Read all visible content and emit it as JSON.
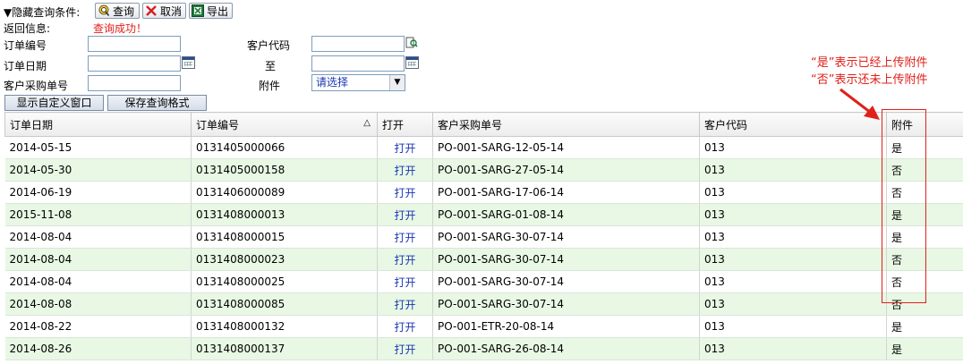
{
  "toolbar": {
    "toggle_label": "▼隐藏查询条件:",
    "query_label": "查询",
    "cancel_label": "取消",
    "export_label": "导出"
  },
  "message": {
    "label": "返回信息:",
    "value": "查询成功！"
  },
  "filters": {
    "order_no_label": "订单编号",
    "order_no_value": "",
    "customer_code_label": "客户代码",
    "customer_code_value": "",
    "order_date_label": "订单日期",
    "date_from_value": "",
    "to_label": "至",
    "date_to_value": "",
    "po_no_label": "客户采购单号",
    "po_no_value": "",
    "attachment_label": "附件",
    "attachment_selected": "请选择"
  },
  "buttons": {
    "custom_window": "显示自定义窗口",
    "save_format": "保存查询格式"
  },
  "table": {
    "headers": [
      "订单日期",
      "订单编号",
      "打开",
      "客户采购单号",
      "客户代码",
      "附件"
    ],
    "sort_indicator": "△",
    "rows": [
      [
        "2014-05-15",
        "0131405000066",
        "打开",
        "PO-001-SARG-12-05-14",
        "013",
        "是"
      ],
      [
        "2014-05-30",
        "0131405000158",
        "打开",
        "PO-001-SARG-27-05-14",
        "013",
        "否"
      ],
      [
        "2014-06-19",
        "0131406000089",
        "打开",
        "PO-001-SARG-17-06-14",
        "013",
        "否"
      ],
      [
        "2015-11-08",
        "0131408000013",
        "打开",
        "PO-001-SARG-01-08-14",
        "013",
        "是"
      ],
      [
        "2014-08-04",
        "0131408000015",
        "打开",
        "PO-001-SARG-30-07-14",
        "013",
        "是"
      ],
      [
        "2014-08-04",
        "0131408000023",
        "打开",
        "PO-001-SARG-30-07-14",
        "013",
        "否"
      ],
      [
        "2014-08-04",
        "0131408000025",
        "打开",
        "PO-001-SARG-30-07-14",
        "013",
        "否"
      ],
      [
        "2014-08-08",
        "0131408000085",
        "打开",
        "PO-001-SARG-30-07-14",
        "013",
        "否"
      ],
      [
        "2014-08-22",
        "0131408000132",
        "打开",
        "PO-001-ETR-20-08-14",
        "013",
        "是"
      ],
      [
        "2014-08-26",
        "0131408000137",
        "打开",
        "PO-001-SARG-26-08-14",
        "013",
        "是"
      ]
    ]
  },
  "annotation": {
    "line1": "“是”表示已经上传附件",
    "line2": "“否”表示还未上传附件"
  },
  "colors": {
    "accent_red": "#e0201a",
    "link_blue": "#1a36b4",
    "row_alt": "#e8f8e4"
  }
}
